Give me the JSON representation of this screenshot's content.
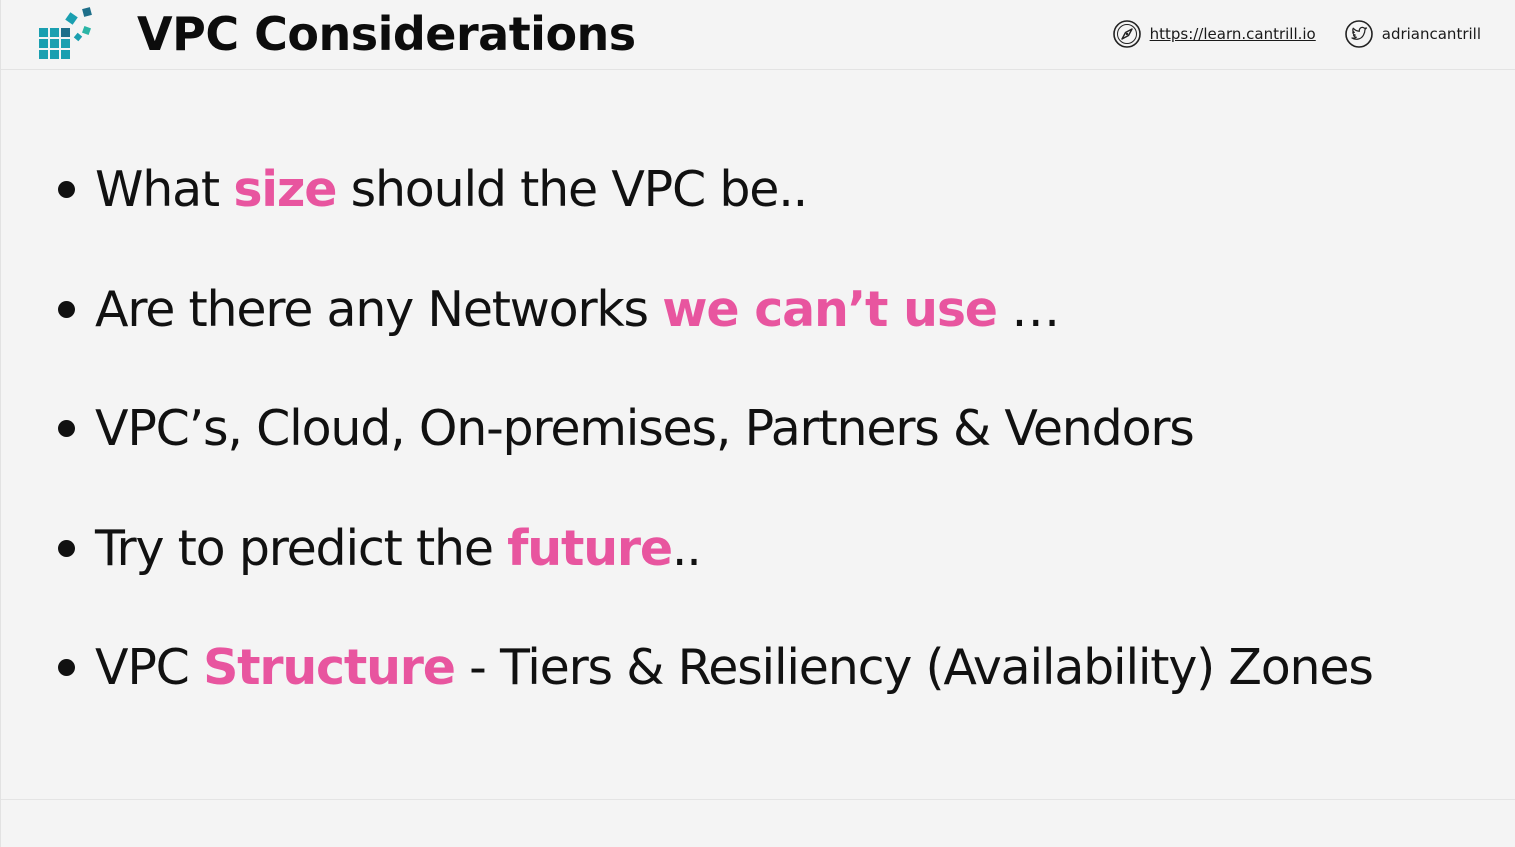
{
  "header": {
    "title": "VPC Considerations",
    "website_url": "https://learn.cantrill.io",
    "twitter_handle": "adriancantrill",
    "logo_colors": [
      "#1a9fb0",
      "#1e6f8a",
      "#2bb5a6"
    ]
  },
  "bullets": [
    {
      "parts": [
        "What ",
        "size",
        " should the VPC be.."
      ]
    },
    {
      "parts": [
        "Are there any Networks ",
        "we can’t use",
        " …"
      ]
    },
    {
      "parts": [
        "VPC’s, Cloud, On-premises, Partners & Vendors"
      ]
    },
    {
      "parts": [
        "Try to predict the ",
        "future",
        ".."
      ]
    },
    {
      "parts": [
        "VPC ",
        "Structure",
        " - Tiers & Resiliency (Availability) Zones"
      ]
    }
  ],
  "colors": {
    "highlight": "#e8559f",
    "background": "#f4f4f4",
    "text": "#111111"
  },
  "icons": {
    "website": "compass-icon",
    "twitter": "twitter-bird-icon",
    "logo": "cantrill-logo-icon"
  }
}
